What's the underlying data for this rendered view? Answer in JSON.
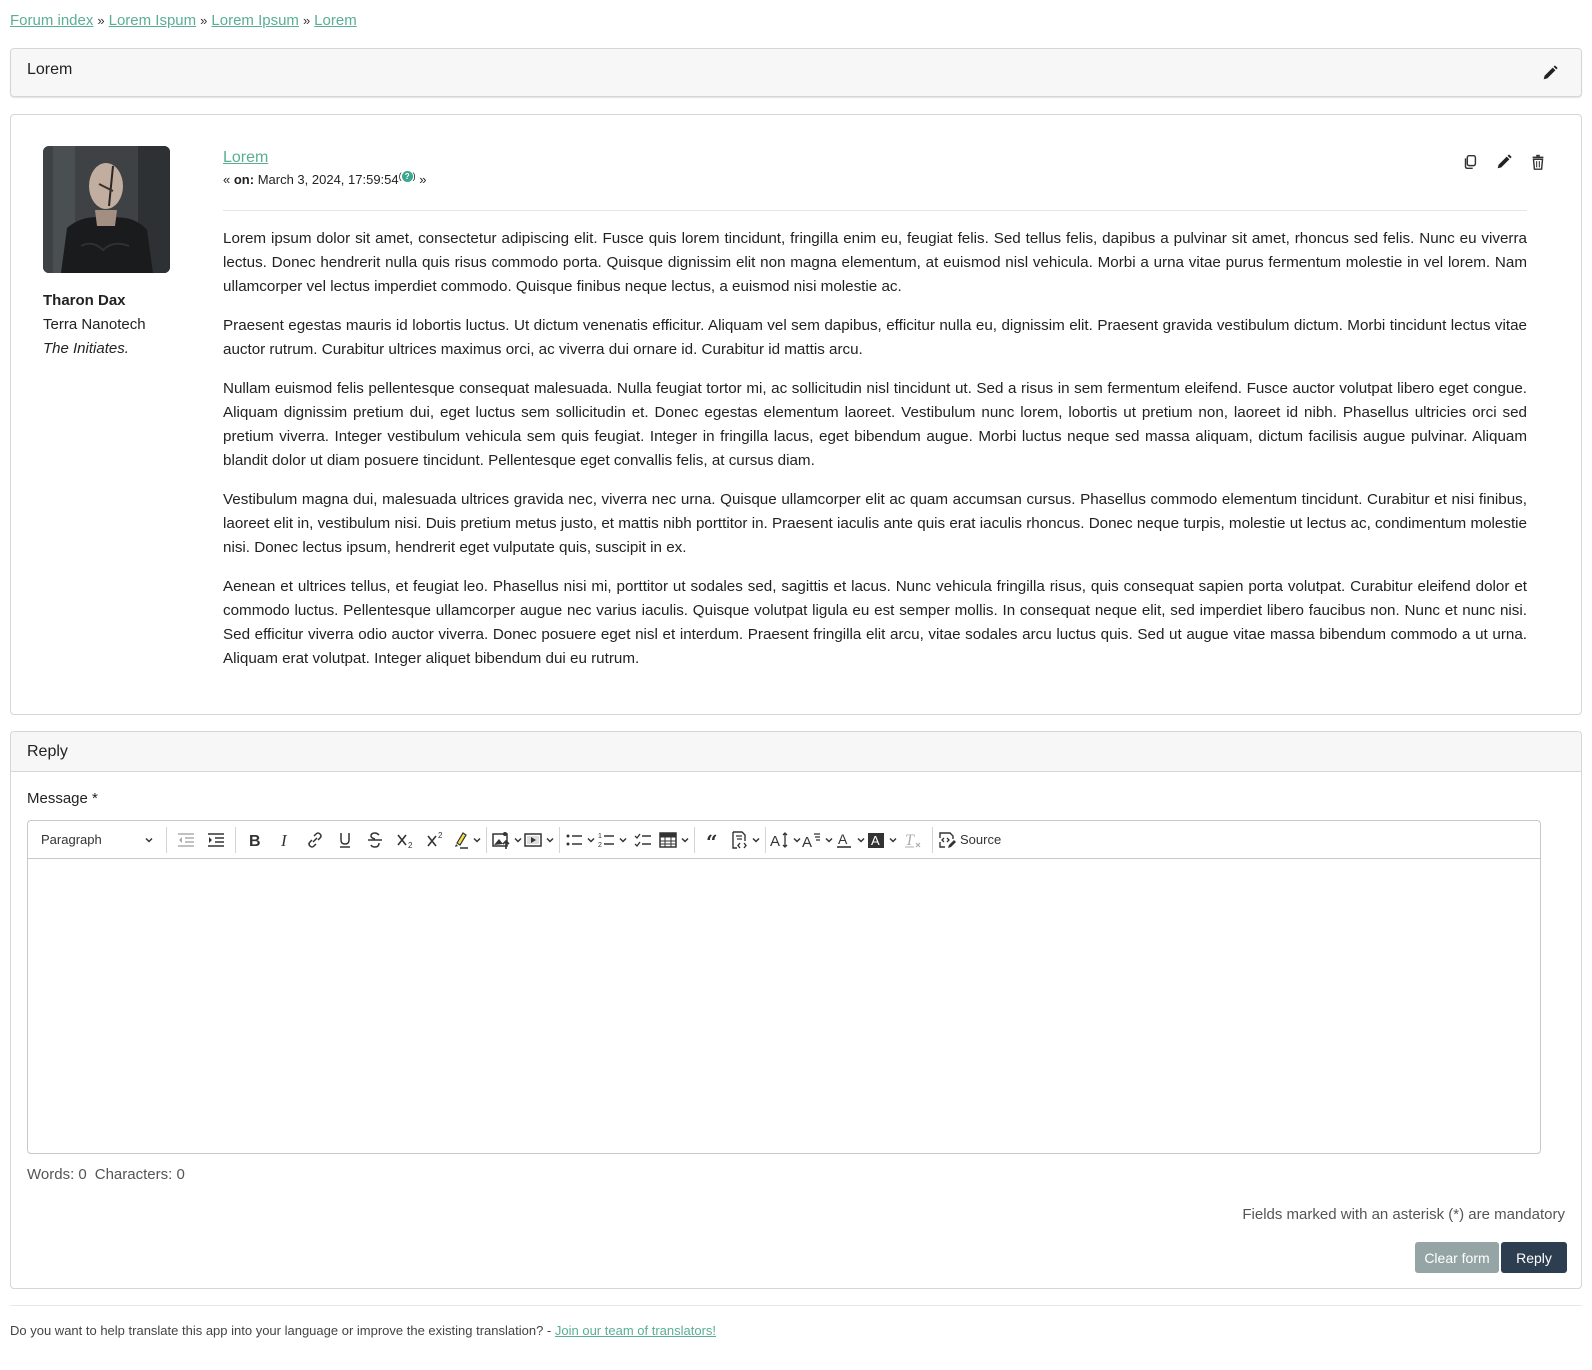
{
  "breadcrumb": [
    {
      "label": "Forum index"
    },
    {
      "label": "Lorem Ispum"
    },
    {
      "label": "Lorem Ipsum"
    },
    {
      "label": "Lorem"
    }
  ],
  "breadcrumb_separator": "»",
  "topic": {
    "title": "Lorem",
    "edit_icon": "pencil-icon"
  },
  "post": {
    "author": {
      "name": "Tharon Dax",
      "corporation": "Terra Nanotech",
      "group": "The Initiates."
    },
    "subject": "Lorem",
    "meta_prefix": "«",
    "meta_on_label": "on:",
    "meta_date": "March 3, 2024, 17:59:54",
    "meta_help_icon": "?",
    "meta_suffix": "»",
    "actions": [
      {
        "name": "quote",
        "icon": "copy-icon"
      },
      {
        "name": "edit",
        "icon": "pencil-icon"
      },
      {
        "name": "delete",
        "icon": "trash-icon"
      }
    ],
    "paragraphs": [
      "Lorem ipsum dolor sit amet, consectetur adipiscing elit. Fusce quis lorem tincidunt, fringilla enim eu, feugiat felis. Sed tellus felis, dapibus a pulvinar sit amet, rhoncus sed felis. Nunc eu viverra lectus. Donec hendrerit nulla quis risus commodo porta. Quisque dignissim elit non magna elementum, at euismod nisl vehicula. Morbi a urna vitae purus fermentum molestie in vel lorem. Nam ullamcorper vel lectus imperdiet commodo. Quisque finibus neque lectus, a euismod nisi molestie ac.",
      "Praesent egestas mauris id lobortis luctus. Ut dictum venenatis efficitur. Aliquam vel sem dapibus, efficitur nulla eu, dignissim elit. Praesent gravida vestibulum dictum. Morbi tincidunt lectus vitae auctor rutrum. Curabitur ultrices maximus orci, ac viverra dui ornare id. Curabitur id mattis arcu.",
      "Nullam euismod felis pellentesque consequat malesuada. Nulla feugiat tortor mi, ac sollicitudin nisl tincidunt ut. Sed a risus in sem fermentum eleifend. Fusce auctor volutpat libero eget congue. Aliquam dignissim pretium dui, eget luctus sem sollicitudin et. Donec egestas elementum laoreet. Vestibulum nunc lorem, lobortis ut pretium non, laoreet id nibh. Phasellus ultricies orci sed pretium viverra. Integer vestibulum vehicula sem quis feugiat. Integer in fringilla lacus, eget bibendum augue. Morbi luctus neque sed massa aliquam, dictum facilisis augue pulvinar. Aliquam blandit dolor ut diam posuere tincidunt. Pellentesque eget convallis felis, at cursus diam.",
      "Vestibulum magna dui, malesuada ultrices gravida nec, viverra nec urna. Quisque ullamcorper elit ac quam accumsan cursus. Phasellus commodo elementum tincidunt. Curabitur et nisi finibus, laoreet elit in, vestibulum nisi. Duis pretium metus justo, et mattis nibh porttitor in. Praesent iaculis ante quis erat iaculis rhoncus. Donec neque turpis, molestie ut lectus ac, condimentum molestie nisi. Donec lectus ipsum, hendrerit eget vulputate quis, suscipit in ex.",
      "Aenean et ultrices tellus, et feugiat leo. Phasellus nisi mi, porttitor ut sodales sed, sagittis et lacus. Nunc vehicula fringilla risus, quis consequat sapien porta volutpat. Curabitur eleifend dolor et commodo luctus. Pellentesque ullamcorper augue nec varius iaculis. Quisque volutpat ligula eu est semper mollis. In consequat neque elit, sed imperdiet libero faucibus non. Nunc et nunc nisi. Sed efficitur viverra odio auctor viverra. Donec posuere eget nisl et interdum. Praesent fringilla elit arcu, vitae sodales arcu luctus quis. Sed ut augue vitae massa bibendum commodo a ut urna. Aliquam erat volutpat. Integer aliquet bibendum dui eu rutrum."
    ]
  },
  "reply": {
    "header": "Reply",
    "message_label": "Message *",
    "editor": {
      "heading_select": "Paragraph",
      "toolbar": [
        {
          "name": "outdent",
          "icon": "outdent-icon",
          "disabled": true
        },
        {
          "name": "indent",
          "icon": "indent-icon"
        },
        {
          "name": "bold",
          "icon": "bold-icon"
        },
        {
          "name": "italic",
          "icon": "italic-icon"
        },
        {
          "name": "link",
          "icon": "link-icon"
        },
        {
          "name": "underline",
          "icon": "underline-icon"
        },
        {
          "name": "strikethrough",
          "icon": "strikethrough-icon"
        },
        {
          "name": "subscript",
          "icon": "subscript-icon"
        },
        {
          "name": "superscript",
          "icon": "superscript-icon"
        },
        {
          "name": "highlight",
          "icon": "highlighter-icon",
          "dropdown": true
        },
        {
          "name": "insert-image",
          "icon": "image-upload-icon",
          "dropdown": true
        },
        {
          "name": "media-embed",
          "icon": "media-icon",
          "dropdown": true
        },
        {
          "name": "bulleted-list",
          "icon": "bulleted-list-icon",
          "dropdown": true
        },
        {
          "name": "numbered-list",
          "icon": "numbered-list-icon",
          "dropdown": true
        },
        {
          "name": "todo-list",
          "icon": "todo-list-icon"
        },
        {
          "name": "insert-table",
          "icon": "table-icon",
          "dropdown": true
        },
        {
          "name": "block-quote",
          "icon": "quote-icon"
        },
        {
          "name": "code-block",
          "icon": "code-block-icon",
          "dropdown": true
        },
        {
          "name": "font-size",
          "icon": "font-size-icon",
          "dropdown": true
        },
        {
          "name": "font-family",
          "icon": "font-family-icon",
          "dropdown": true
        },
        {
          "name": "font-color",
          "icon": "font-color-icon",
          "dropdown": true
        },
        {
          "name": "font-background",
          "icon": "font-background-icon",
          "dropdown": true
        },
        {
          "name": "remove-format",
          "icon": "remove-format-icon",
          "disabled": true
        },
        {
          "name": "source",
          "icon": "source-icon",
          "label": "Source"
        }
      ],
      "content": ""
    },
    "word_count": "Words: 0",
    "char_count": "Characters: 0",
    "mandatory_note": "Fields marked with an asterisk (*) are mandatory",
    "clear_button": "Clear form",
    "submit_button": "Reply"
  },
  "footer": {
    "text": "Do you want to help translate this app into your language or improve the existing translation? -",
    "link": "Join our team of translators!"
  },
  "colors": {
    "link": "#5aae95",
    "primary_button": "#2c3e50",
    "secondary_button": "#95a5a6",
    "help_badge": "#3aa88c"
  }
}
